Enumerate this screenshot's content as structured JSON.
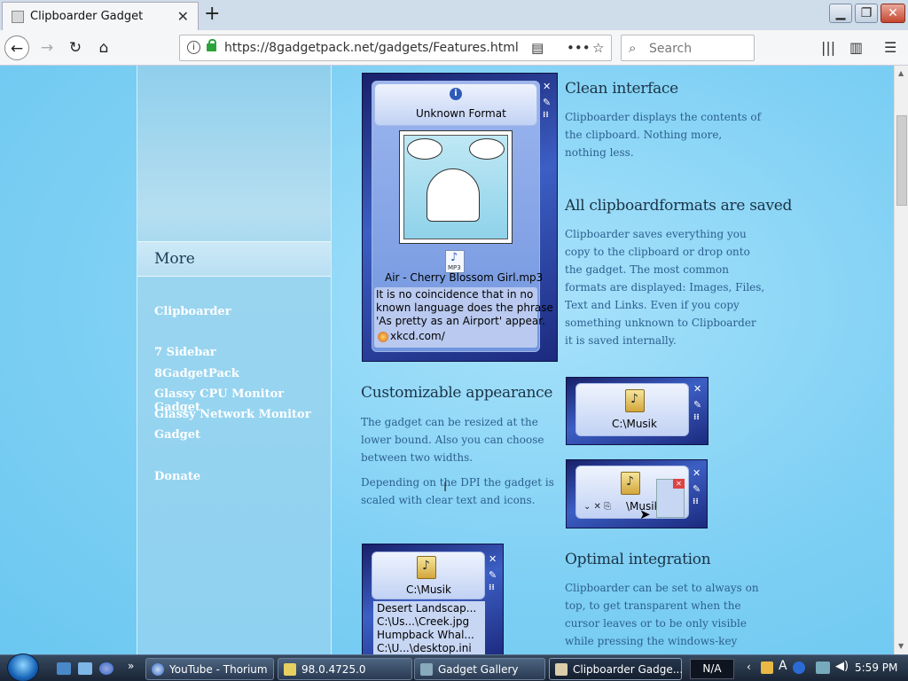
{
  "browser": {
    "tab_title": "Clipboarder Gadget",
    "tab_close": "✕",
    "new_tab": "+",
    "url": "https://8gadgetpack.net/gadgets/Features.html",
    "search_placeholder": "Search"
  },
  "window_controls": {
    "minimize": "▁",
    "maximize": "❐",
    "close": "✕"
  },
  "sidebar": {
    "more_heading": "More",
    "links": [
      "Clipboarder",
      "7 Sidebar",
      "8GadgetPack",
      "Glassy CPU Monitor Gadget",
      "Glassy Network Monitor",
      "Gadget",
      "Donate"
    ]
  },
  "gadget_main": {
    "format_label": "Unknown Format",
    "file_name": "Air - Cherry Blossom Girl.mp3",
    "file_type": "MP3",
    "quote_lines": [
      "It is no coincidence that in no",
      "known language does the phrase",
      "'As pretty as an Airport' appear."
    ],
    "link": "xkcd.com/"
  },
  "sections": {
    "clean": {
      "heading": "Clean interface",
      "lines": [
        "Clipboarder displays the contents of",
        "the clipboard. Nothing more,",
        "nothing less."
      ]
    },
    "all_formats": {
      "heading": "All clipboardformats are saved",
      "lines": [
        "Clipboarder saves everything you",
        "copy to the clipboard or drop onto",
        "the gadget. The most common",
        "formats are displayed: Images, Files,",
        "Text and Links. Even if you copy",
        "something unknown to Clipboarder",
        "it is saved internally."
      ]
    },
    "custom": {
      "heading": "Customizable appearance",
      "lines1": [
        "The gadget can be resized at the",
        "lower bound. Also you can choose",
        "between two widths."
      ],
      "lines2": [
        "Depending on the DPI the gadget is",
        "scaled with clear text and icons."
      ]
    },
    "integration": {
      "heading": "Optimal integration",
      "lines": [
        "Clipboarder can be set to always on",
        "top, to get transparent when the",
        "cursor leaves or to be only visible",
        "while pressing the windows-key"
      ]
    }
  },
  "gadget_small_1": {
    "path": "C:\\Musik"
  },
  "gadget_small_2": {
    "path": "\\Musik"
  },
  "gadget_files": {
    "path": "C:\\Musik",
    "items": [
      "Desert Landscap...",
      "C:\\Us...\\Creek.jpg",
      "Humpback Whal...",
      "C:\\U...\\desktop.ini"
    ]
  },
  "taskbar": {
    "tasks": [
      "YouTube - Thorium",
      "98.0.4725.0",
      "Gadget Gallery",
      "Clipboarder Gadge..."
    ],
    "language": "N/A",
    "clock": "5:59 PM"
  }
}
